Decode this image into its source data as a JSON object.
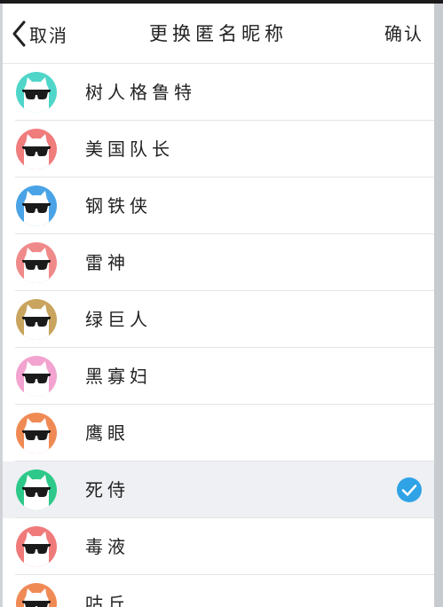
{
  "nav": {
    "back_label": "取消",
    "title": "更换匿名昵称",
    "confirm_label": "确认"
  },
  "colors": {
    "selected_bg": "#eef0f3",
    "check_blue": "#2fa3e6"
  },
  "nicknames": [
    {
      "name": "树人格鲁特",
      "avatar_color": "#4fd6c9",
      "icon": "cat-sunglasses-avatar",
      "selected": false
    },
    {
      "name": "美国队长",
      "avatar_color": "#f07c7c",
      "icon": "cat-sunglasses-avatar",
      "selected": false
    },
    {
      "name": "钢铁侠",
      "avatar_color": "#4aa3e6",
      "icon": "cat-sunglasses-avatar",
      "selected": false
    },
    {
      "name": "雷神",
      "avatar_color": "#f08a8a",
      "icon": "cat-sunglasses-avatar",
      "selected": false
    },
    {
      "name": "绿巨人",
      "avatar_color": "#c9a45e",
      "icon": "cat-sunglasses-avatar",
      "selected": false
    },
    {
      "name": "黑寡妇",
      "avatar_color": "#f2a3cf",
      "icon": "cat-sunglasses-avatar",
      "selected": false
    },
    {
      "name": "鹰眼",
      "avatar_color": "#f08a55",
      "icon": "cat-sunglasses-avatar",
      "selected": false
    },
    {
      "name": "死侍",
      "avatar_color": "#2ec98a",
      "icon": "cat-sunglasses-avatar",
      "selected": true
    },
    {
      "name": "毒液",
      "avatar_color": "#f07a7a",
      "icon": "cat-sunglasses-avatar",
      "selected": false
    },
    {
      "name": "咕丘",
      "avatar_color": "#f08a55",
      "icon": "cat-sunglasses-avatar",
      "selected": false
    }
  ]
}
